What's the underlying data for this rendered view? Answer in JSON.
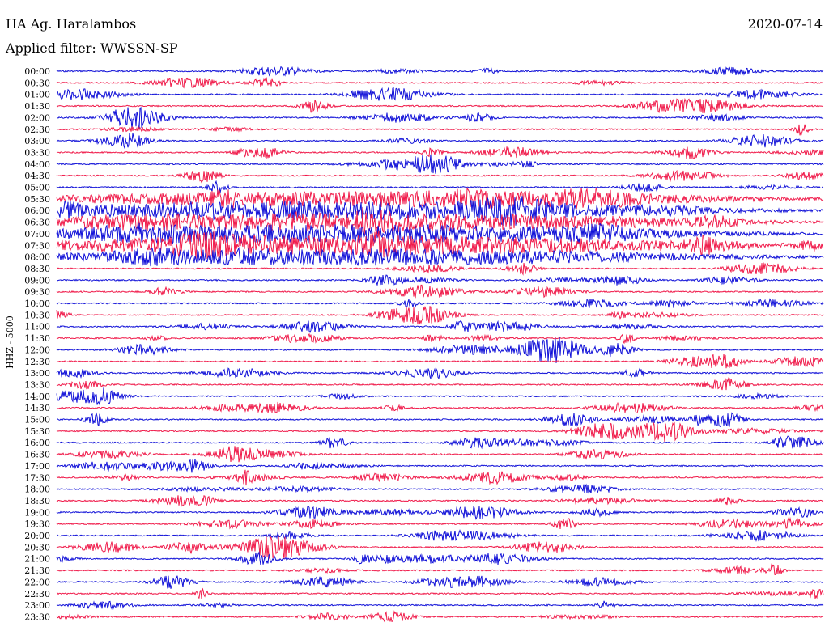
{
  "header": {
    "station": "HA Ag. Haralambos",
    "date": "2020-07-14",
    "filter_label": "Applied filter: WWSSN-SP"
  },
  "axis": {
    "channel_label": "HHZ - 5000"
  },
  "colors": {
    "trace_a": "#1010d8",
    "trace_b": "#f01a4a"
  },
  "time_labels": [
    "00:00",
    "00:30",
    "01:00",
    "01:30",
    "02:00",
    "02:30",
    "03:00",
    "03:30",
    "04:00",
    "04:30",
    "05:00",
    "05:30",
    "06:00",
    "06:30",
    "07:00",
    "07:30",
    "08:00",
    "08:30",
    "09:00",
    "09:30",
    "10:00",
    "10:30",
    "11:00",
    "11:30",
    "12:00",
    "12:30",
    "13:00",
    "13:30",
    "14:00",
    "14:30",
    "15:00",
    "15:30",
    "16:00",
    "16:30",
    "17:00",
    "17:30",
    "18:00",
    "18:30",
    "19:00",
    "19:30",
    "20:00",
    "20:30",
    "21:00",
    "21:30",
    "22:00",
    "22:30",
    "23:00",
    "23:30"
  ]
}
